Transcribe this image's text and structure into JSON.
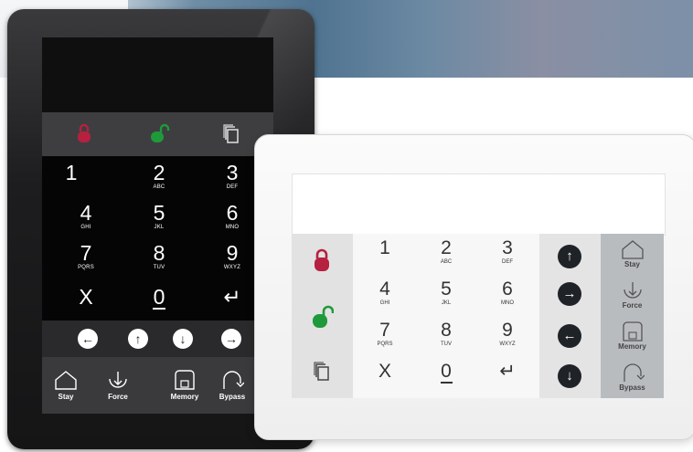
{
  "dark_keypad": {
    "keys": [
      {
        "digit": "1",
        "letters": ""
      },
      {
        "digit": "2",
        "letters": "ABC"
      },
      {
        "digit": "3",
        "letters": "DEF"
      },
      {
        "digit": "4",
        "letters": "GHI"
      },
      {
        "digit": "5",
        "letters": "JKL"
      },
      {
        "digit": "6",
        "letters": "MNO"
      },
      {
        "digit": "7",
        "letters": "PQRS"
      },
      {
        "digit": "8",
        "letters": "TUV"
      },
      {
        "digit": "9",
        "letters": "WXYZ"
      },
      {
        "digit": "X",
        "letters": ""
      },
      {
        "digit": "0",
        "letters": ""
      },
      {
        "digit": "↵",
        "letters": ""
      }
    ],
    "arrows": [
      "←",
      "↑",
      "↓",
      "→"
    ],
    "functions": [
      "Stay",
      "Force",
      "Memory",
      "Bypass"
    ]
  },
  "white_keypad": {
    "keys": [
      {
        "digit": "1",
        "letters": ""
      },
      {
        "digit": "2",
        "letters": "ABC"
      },
      {
        "digit": "3",
        "letters": "DEF"
      },
      {
        "digit": "4",
        "letters": "GHI"
      },
      {
        "digit": "5",
        "letters": "JKL"
      },
      {
        "digit": "6",
        "letters": "MNO"
      },
      {
        "digit": "7",
        "letters": "PQRS"
      },
      {
        "digit": "8",
        "letters": "TUV"
      },
      {
        "digit": "9",
        "letters": "WXYZ"
      },
      {
        "digit": "X",
        "letters": ""
      },
      {
        "digit": "0",
        "letters": ""
      },
      {
        "digit": "↵",
        "letters": ""
      }
    ],
    "arrows": [
      "↑",
      "→",
      "←",
      "↓"
    ],
    "functions": [
      "Stay",
      "Force",
      "Memory",
      "Bypass"
    ]
  },
  "colors": {
    "lock_red": "#b5213f",
    "unlock_green": "#1f9a3a",
    "dark_body": "#1d1d1f",
    "white_body": "#f2f2f2",
    "function_panel": "#b9bcbf"
  },
  "icons": [
    "lock-closed-icon",
    "lock-open-icon",
    "copy-icon",
    "home-icon",
    "force-arrow-icon",
    "memory-icon",
    "bypass-icon"
  ]
}
